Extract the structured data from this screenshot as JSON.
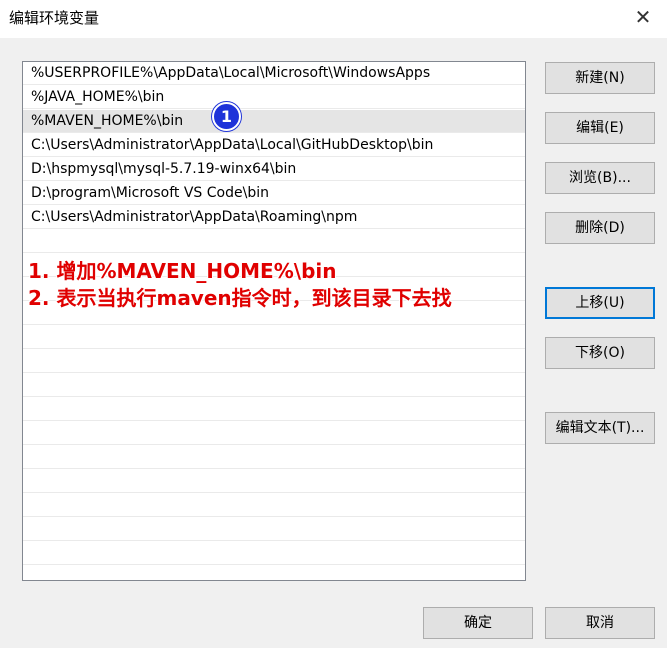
{
  "window": {
    "title": "编辑环境变量",
    "close_glyph": "✕"
  },
  "list": {
    "items": [
      "%USERPROFILE%\\AppData\\Local\\Microsoft\\WindowsApps",
      "%JAVA_HOME%\\bin",
      "%MAVEN_HOME%\\bin",
      "C:\\Users\\Administrator\\AppData\\Local\\GitHubDesktop\\bin",
      "D:\\hspmysql\\mysql-5.7.19-winx64\\bin",
      "D:\\program\\Microsoft VS Code\\bin",
      "C:\\Users\\Administrator\\AppData\\Roaming\\npm"
    ],
    "selected_index": 2
  },
  "buttons": {
    "new": "新建(N)",
    "edit": "编辑(E)",
    "browse": "浏览(B)...",
    "delete": "删除(D)",
    "move_up": "上移(U)",
    "move_down": "下移(O)",
    "edit_text": "编辑文本(T)...",
    "ok": "确定",
    "cancel": "取消"
  },
  "annotation": {
    "badge": "1",
    "line1": "1. 增加%MAVEN_HOME%\\bin",
    "line2": "2. 表示当执行maven指令时，到该目录下去找",
    "color": "#e00000"
  },
  "colors": {
    "focus": "#0078d7",
    "badge": "#1f33d9"
  }
}
